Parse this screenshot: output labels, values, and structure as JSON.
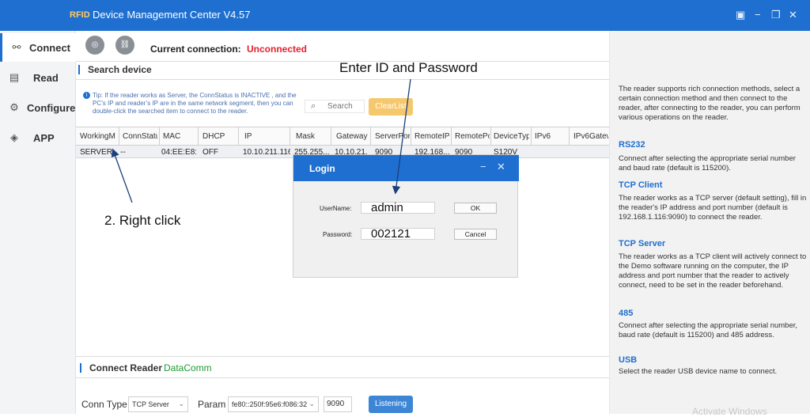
{
  "titlebar": {
    "brand": "RFID",
    "title": "Device Management Center V4.57",
    "controls": [
      "▣",
      "−",
      "❐",
      "✕"
    ]
  },
  "sidebar": {
    "items": [
      {
        "label": "Connect",
        "icon": "network-icon",
        "glyph": "⚯"
      },
      {
        "label": "Read",
        "icon": "card-icon",
        "glyph": "▤"
      },
      {
        "label": "Configure",
        "icon": "settings-icon",
        "glyph": "⚙"
      },
      {
        "label": "APP",
        "icon": "cube-icon",
        "glyph": "◈"
      }
    ]
  },
  "toolbar": {
    "search_icon": "search-device-icon",
    "link_icon": "disconnect-icon",
    "current_connection_label": "Current connection:",
    "current_connection_value": "Unconnected"
  },
  "search_device": {
    "title": "Search device",
    "tip": "Tip: If the reader works as Server, the ConnStatus is INACTIVE , and the PC’s IP and reader’s IP are in the same network segment, then you can double-click the searched item to connect to the reader.",
    "search_placeholder": "Search",
    "clear_list_label": "ClearList",
    "columns": [
      "WorkingM",
      "ConnStatu",
      "MAC",
      "DHCP",
      "IP",
      "Mask",
      "Gateway",
      "ServerPor",
      "RemoteIP",
      "RemotePo",
      "DeviceTyp",
      "IPv6",
      "IPv6Gatew"
    ],
    "rows": [
      [
        "SERVER",
        "--",
        "04:EE:E8:...",
        "OFF",
        "10.10.211.116",
        "255.255...",
        "10.10.21...",
        "9090",
        "192.168...",
        "9090",
        "S120V",
        "",
        ""
      ]
    ]
  },
  "connect_reader": {
    "title": "Connect Reader",
    "tab": "DataComm",
    "conn_type_label": "Conn Type",
    "conn_type_value": "TCP Server",
    "param_label": "Param",
    "param_value": "fe80::250f:95e6:f086:32",
    "port_value": "9090",
    "listening_label": "Listening"
  },
  "help": {
    "intro": "The reader supports rich connection methods, select a certain connection method and then connect to the reader, after connecting to the reader, you can perform various operations on the reader.",
    "sections": [
      {
        "heading": "RS232",
        "text": "Connect after selecting the appropriate serial number and baud rate (default is 115200)."
      },
      {
        "heading": "TCP Client",
        "text": "The reader works as a TCP server (default setting), fill in the reader's IP address and port number (default is 192.168.1.116:9090) to connect the reader."
      },
      {
        "heading": "TCP Server",
        "text": "The reader works as a TCP client will actively connect to the Demo software running on the computer, the IP address and port number that the reader to actively connect, need  to be set in the reader beforehand."
      },
      {
        "heading": "485",
        "text": "Connect after selecting the appropriate serial number, baud rate (default is 115200) and 485 address."
      },
      {
        "heading": "USB",
        "text": "Select the reader USB device name to connect."
      }
    ],
    "watermark": "Activate Windows"
  },
  "login": {
    "title": "Login",
    "username_label": "UserName:",
    "username_value": "admin",
    "password_label": "Password:",
    "password_value": "002121",
    "ok_label": "OK",
    "cancel_label": "Cancel"
  },
  "annotations": {
    "enter_id": "Enter ID and Password",
    "right_click": "2. Right click"
  }
}
